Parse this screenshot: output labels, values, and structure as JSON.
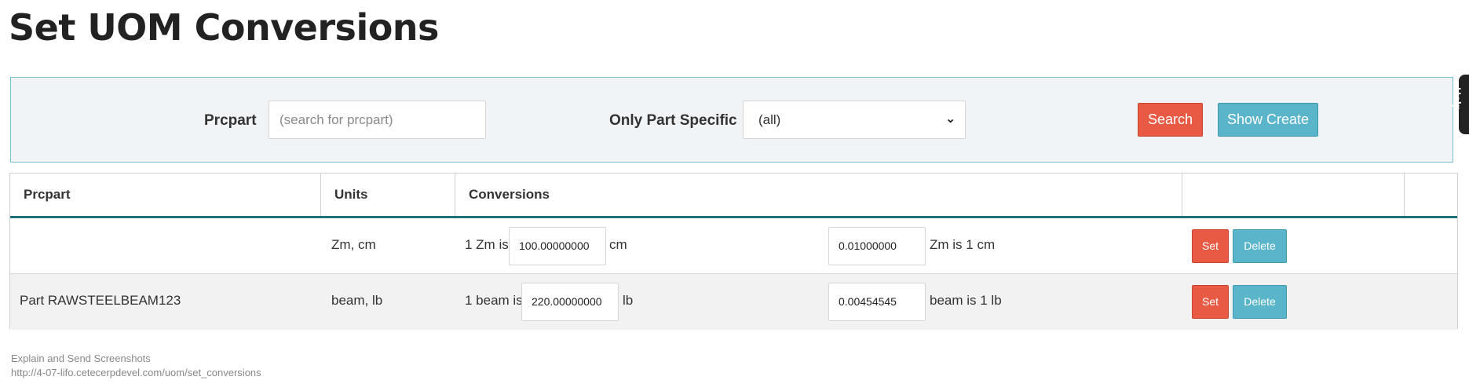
{
  "page": {
    "title": "Set UOM Conversions"
  },
  "filters": {
    "prcpart_label": "Prcpart",
    "prcpart_placeholder": "(search for prcpart)",
    "only_part_specific_label": "Only Part Specific",
    "only_part_specific_value": "(all)",
    "search_button": "Search",
    "show_create_button": "Show Create"
  },
  "help_tab": {
    "label": "Help"
  },
  "table": {
    "headers": [
      "Prcpart",
      "Units",
      "Conversions",
      "",
      ""
    ],
    "rows": [
      {
        "prcpart": "",
        "units": "Zm, cm",
        "from_prefix": "1 Zm is",
        "from_value": "100.00000000",
        "from_suffix": "cm",
        "to_value": "0.01000000",
        "to_suffix": "Zm is 1 cm",
        "set_label": "Set",
        "delete_label": "Delete"
      },
      {
        "prcpart": "Part RAWSTEELBEAM123",
        "units": "beam, lb",
        "from_prefix": "1 beam is",
        "from_value": "220.00000000",
        "from_suffix": "lb",
        "to_value": "0.00454545",
        "to_suffix": "beam is 1 lb",
        "set_label": "Set",
        "delete_label": "Delete"
      }
    ]
  },
  "footer": {
    "link_text": "Explain and Send Screenshots",
    "url": "http://4-07-lifo.cetecerpdevel.com/uom/set_conversions"
  }
}
